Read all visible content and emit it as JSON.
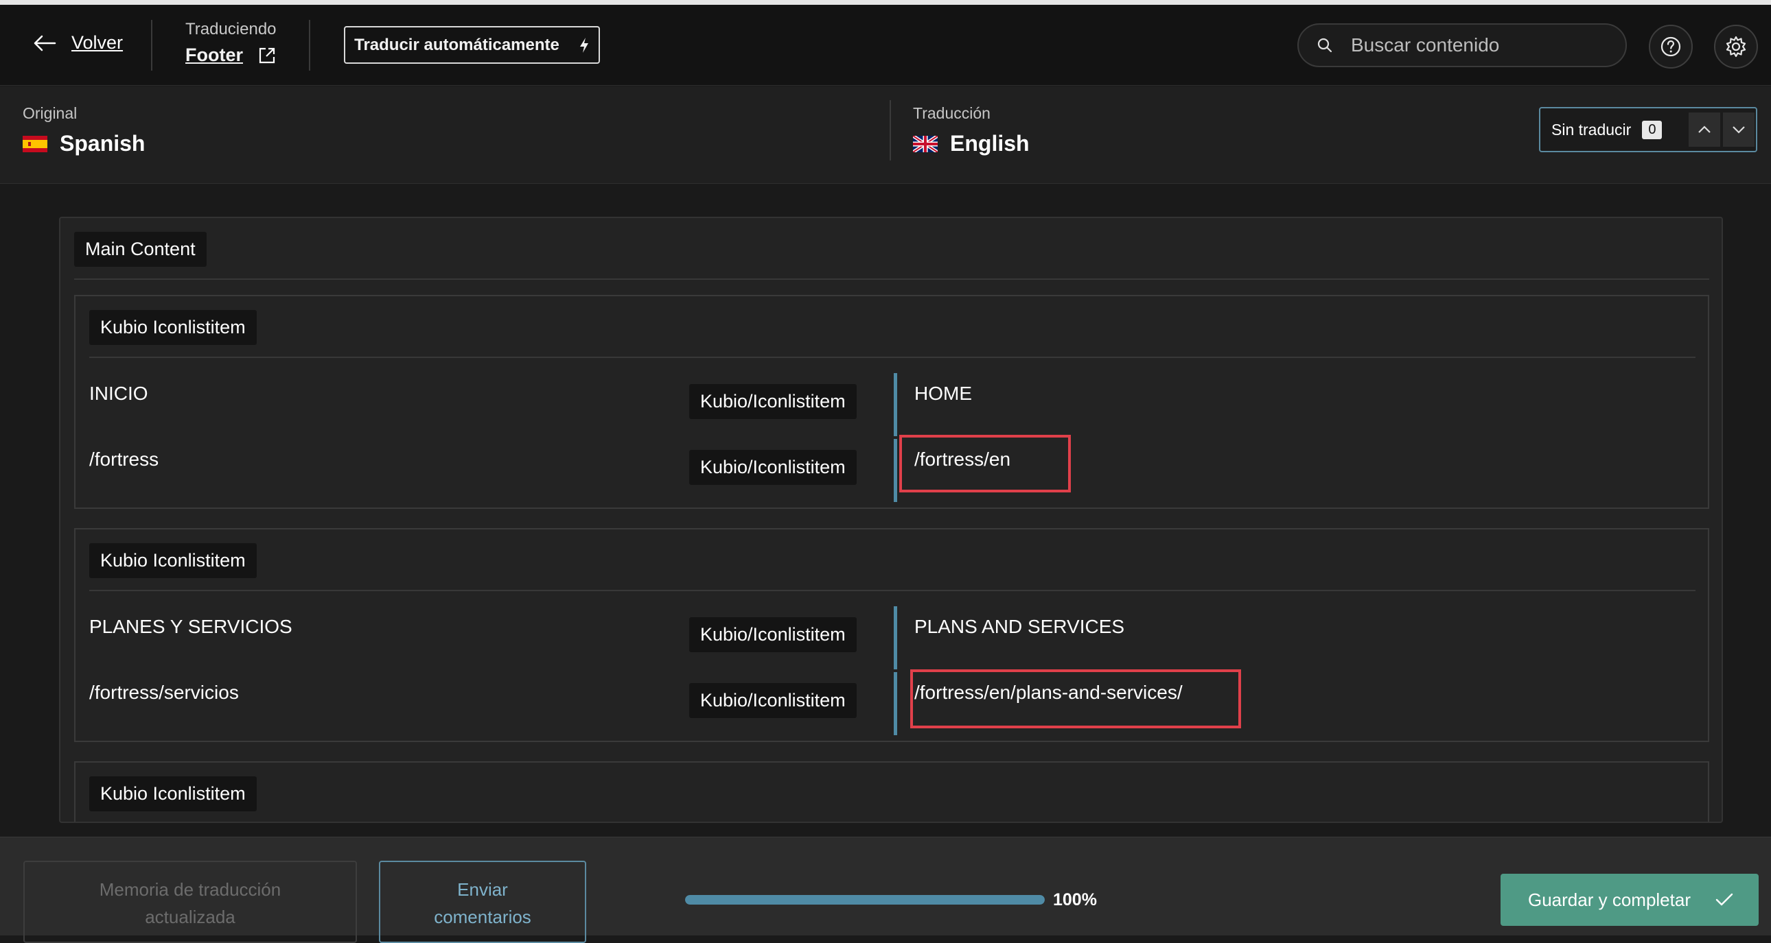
{
  "header": {
    "back_label": "Volver",
    "translating_label": "Traduciendo",
    "page_name": "Footer",
    "auto_translate_label": "Traducir automáticamente",
    "search_placeholder": "Buscar contenido"
  },
  "languages": {
    "original_label": "Original",
    "original_name": "Spanish",
    "translation_label": "Traducción",
    "translation_name": "English"
  },
  "filter": {
    "label": "Sin traducir",
    "count": "0"
  },
  "content": {
    "section_label": "Main Content",
    "groups": [
      {
        "label": "Kubio Iconlistitem",
        "rows": [
          {
            "original": "INICIO",
            "type": "Kubio/Iconlistitem",
            "translation": "HOME"
          },
          {
            "original": "/fortress",
            "type": "Kubio/Iconlistitem",
            "translation": "/fortress/en"
          }
        ]
      },
      {
        "label": "Kubio Iconlistitem",
        "rows": [
          {
            "original": "PLANES Y SERVICIOS",
            "type": "Kubio/Iconlistitem",
            "translation": "PLANS AND SERVICES"
          },
          {
            "original": "/fortress/servicios",
            "type": "Kubio/Iconlistitem",
            "translation": "/fortress/en/plans-and-services/"
          }
        ]
      },
      {
        "label": "Kubio Iconlistitem"
      }
    ]
  },
  "footer": {
    "memory_line1": "Memoria de traducción",
    "memory_line2": "actualizada",
    "feedback_line1": "Enviar",
    "feedback_line2": "comentarios",
    "progress_percent": 100,
    "progress_label": "100%",
    "save_label": "Guardar y completar"
  },
  "colors": {
    "accent_blue": "#4f8ba6",
    "save_green": "#4f9a85",
    "highlight_red": "#e0404a"
  }
}
